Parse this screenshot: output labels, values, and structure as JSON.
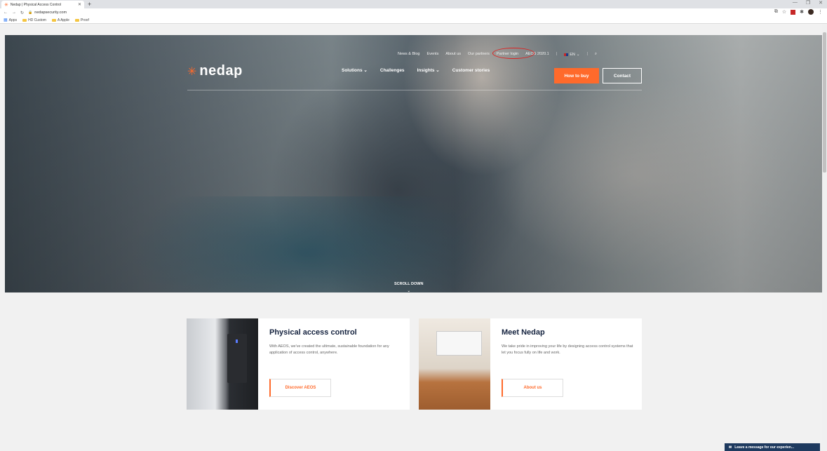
{
  "browser": {
    "tab_title": "Nedap | Physical Access Control",
    "url": "nedapsecurity.com",
    "bookmarks": [
      "Apps",
      "HD Custom",
      "A Apple",
      "Proof"
    ]
  },
  "nav": {
    "top_links": [
      "News & Blog",
      "Events",
      "About us",
      "Our partners",
      "Partner login",
      "AEOS 2020.1"
    ],
    "lang": "EN",
    "logo": "nedap",
    "main_links": [
      "Solutions",
      "Challenges",
      "Insights",
      "Customer stories"
    ],
    "how_to_buy": "How to buy",
    "contact": "Contact"
  },
  "hero": {
    "scroll_text": "SCROLL DOWN"
  },
  "cards": [
    {
      "title": "Physical access control",
      "text": "With AEOS, we've created the ultimate, sustainable foundation for any application of access control, anywhere.",
      "button": "Discover AEOS"
    },
    {
      "title": "Meet Nedap",
      "text": "We take pride in improving your life by designing access control systems that let you focus fully on life and work.",
      "button": "About us"
    }
  ],
  "chat": {
    "label": "Leave a message for our experien..."
  }
}
